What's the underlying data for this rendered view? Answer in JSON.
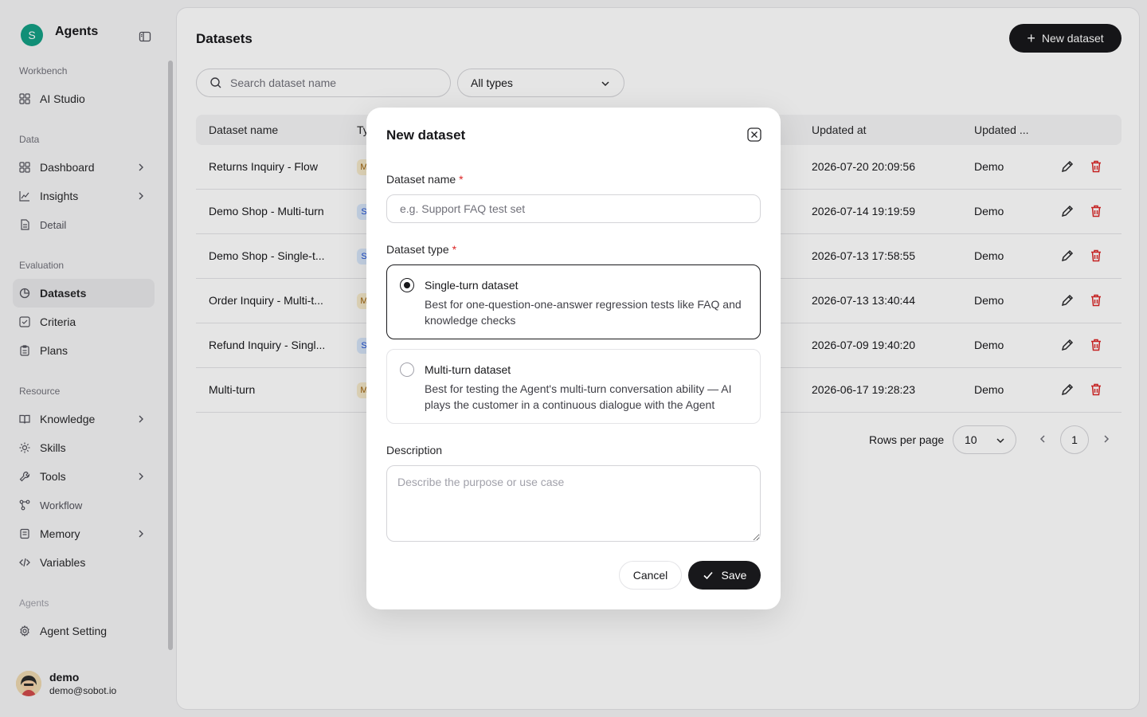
{
  "brand": {
    "initial": "S",
    "name": "Agents"
  },
  "sidebar": {
    "sections": {
      "workbench": "Workbench",
      "data": "Data",
      "evaluation": "Evaluation",
      "resource": "Resource",
      "agents": "Agents"
    },
    "items": {
      "ai_studio": "AI Studio",
      "dashboard": "Dashboard",
      "insights": "Insights",
      "detail": "Detail",
      "datasets": "Datasets",
      "criteria": "Criteria",
      "plans": "Plans",
      "knowledge": "Knowledge",
      "skills": "Skills",
      "tools": "Tools",
      "workflow": "Workflow",
      "memory": "Memory",
      "variables": "Variables",
      "agent_setting": "Agent Setting"
    },
    "active": "datasets"
  },
  "user": {
    "name": "demo",
    "email": "demo@sobot.io"
  },
  "page": {
    "title": "Datasets",
    "new_button": "New dataset",
    "search_placeholder": "Search dataset name",
    "type_filter": "All types"
  },
  "table": {
    "headers": {
      "name": "Dataset name",
      "type": "Ty",
      "updated_at": "Updated at",
      "updated_by": "Updated ..."
    },
    "rows": [
      {
        "name": "Returns Inquiry - Flow",
        "type": "M",
        "updated_at": "2026-07-20 20:09:56",
        "updated_by": "Demo"
      },
      {
        "name": "Demo Shop - Multi-turn",
        "type": "S",
        "updated_at": "2026-07-14 19:19:59",
        "updated_by": "Demo"
      },
      {
        "name": "Demo Shop - Single-t...",
        "type": "S",
        "updated_at": "2026-07-13 17:58:55",
        "updated_by": "Demo"
      },
      {
        "name": "Order Inquiry - Multi-t...",
        "type": "M",
        "updated_at": "2026-07-13 13:40:44",
        "updated_by": "Demo"
      },
      {
        "name": "Refund Inquiry - Singl...",
        "type": "S",
        "updated_at": "2026-07-09 19:40:20",
        "updated_by": "Demo"
      },
      {
        "name": "Multi-turn",
        "type": "M",
        "updated_at": "2026-06-17 19:28:23",
        "updated_by": "Demo"
      }
    ]
  },
  "pagination": {
    "rows_label": "Rows per page",
    "rows_value": "10",
    "current_page": "1"
  },
  "modal": {
    "title": "New dataset",
    "name_label": "Dataset name",
    "required_mark": "*",
    "name_placeholder": "e.g. Support FAQ test set",
    "type_label": "Dataset type",
    "options": [
      {
        "title": "Single-turn dataset",
        "desc": "Best for one-question-one-answer regression tests like FAQ and knowledge checks",
        "selected": true
      },
      {
        "title": "Multi-turn dataset",
        "desc": "Best for testing the Agent's multi-turn conversation ability — AI plays the customer in a continuous dialogue with the Agent",
        "selected": false
      }
    ],
    "description_label": "Description",
    "description_placeholder": "Describe the purpose or use case",
    "cancel": "Cancel",
    "save": "Save"
  },
  "colors": {
    "accent": "#18181b",
    "brand": "#14a085",
    "danger": "#dc2626",
    "required": "#dc2626"
  },
  "icons": {
    "sidebar-toggle": "sidebar-toggle-icon",
    "search": "search-icon",
    "plus": "plus-icon",
    "edit": "pencil-icon",
    "delete": "trash-icon",
    "close": "close-icon",
    "check": "check-icon"
  }
}
